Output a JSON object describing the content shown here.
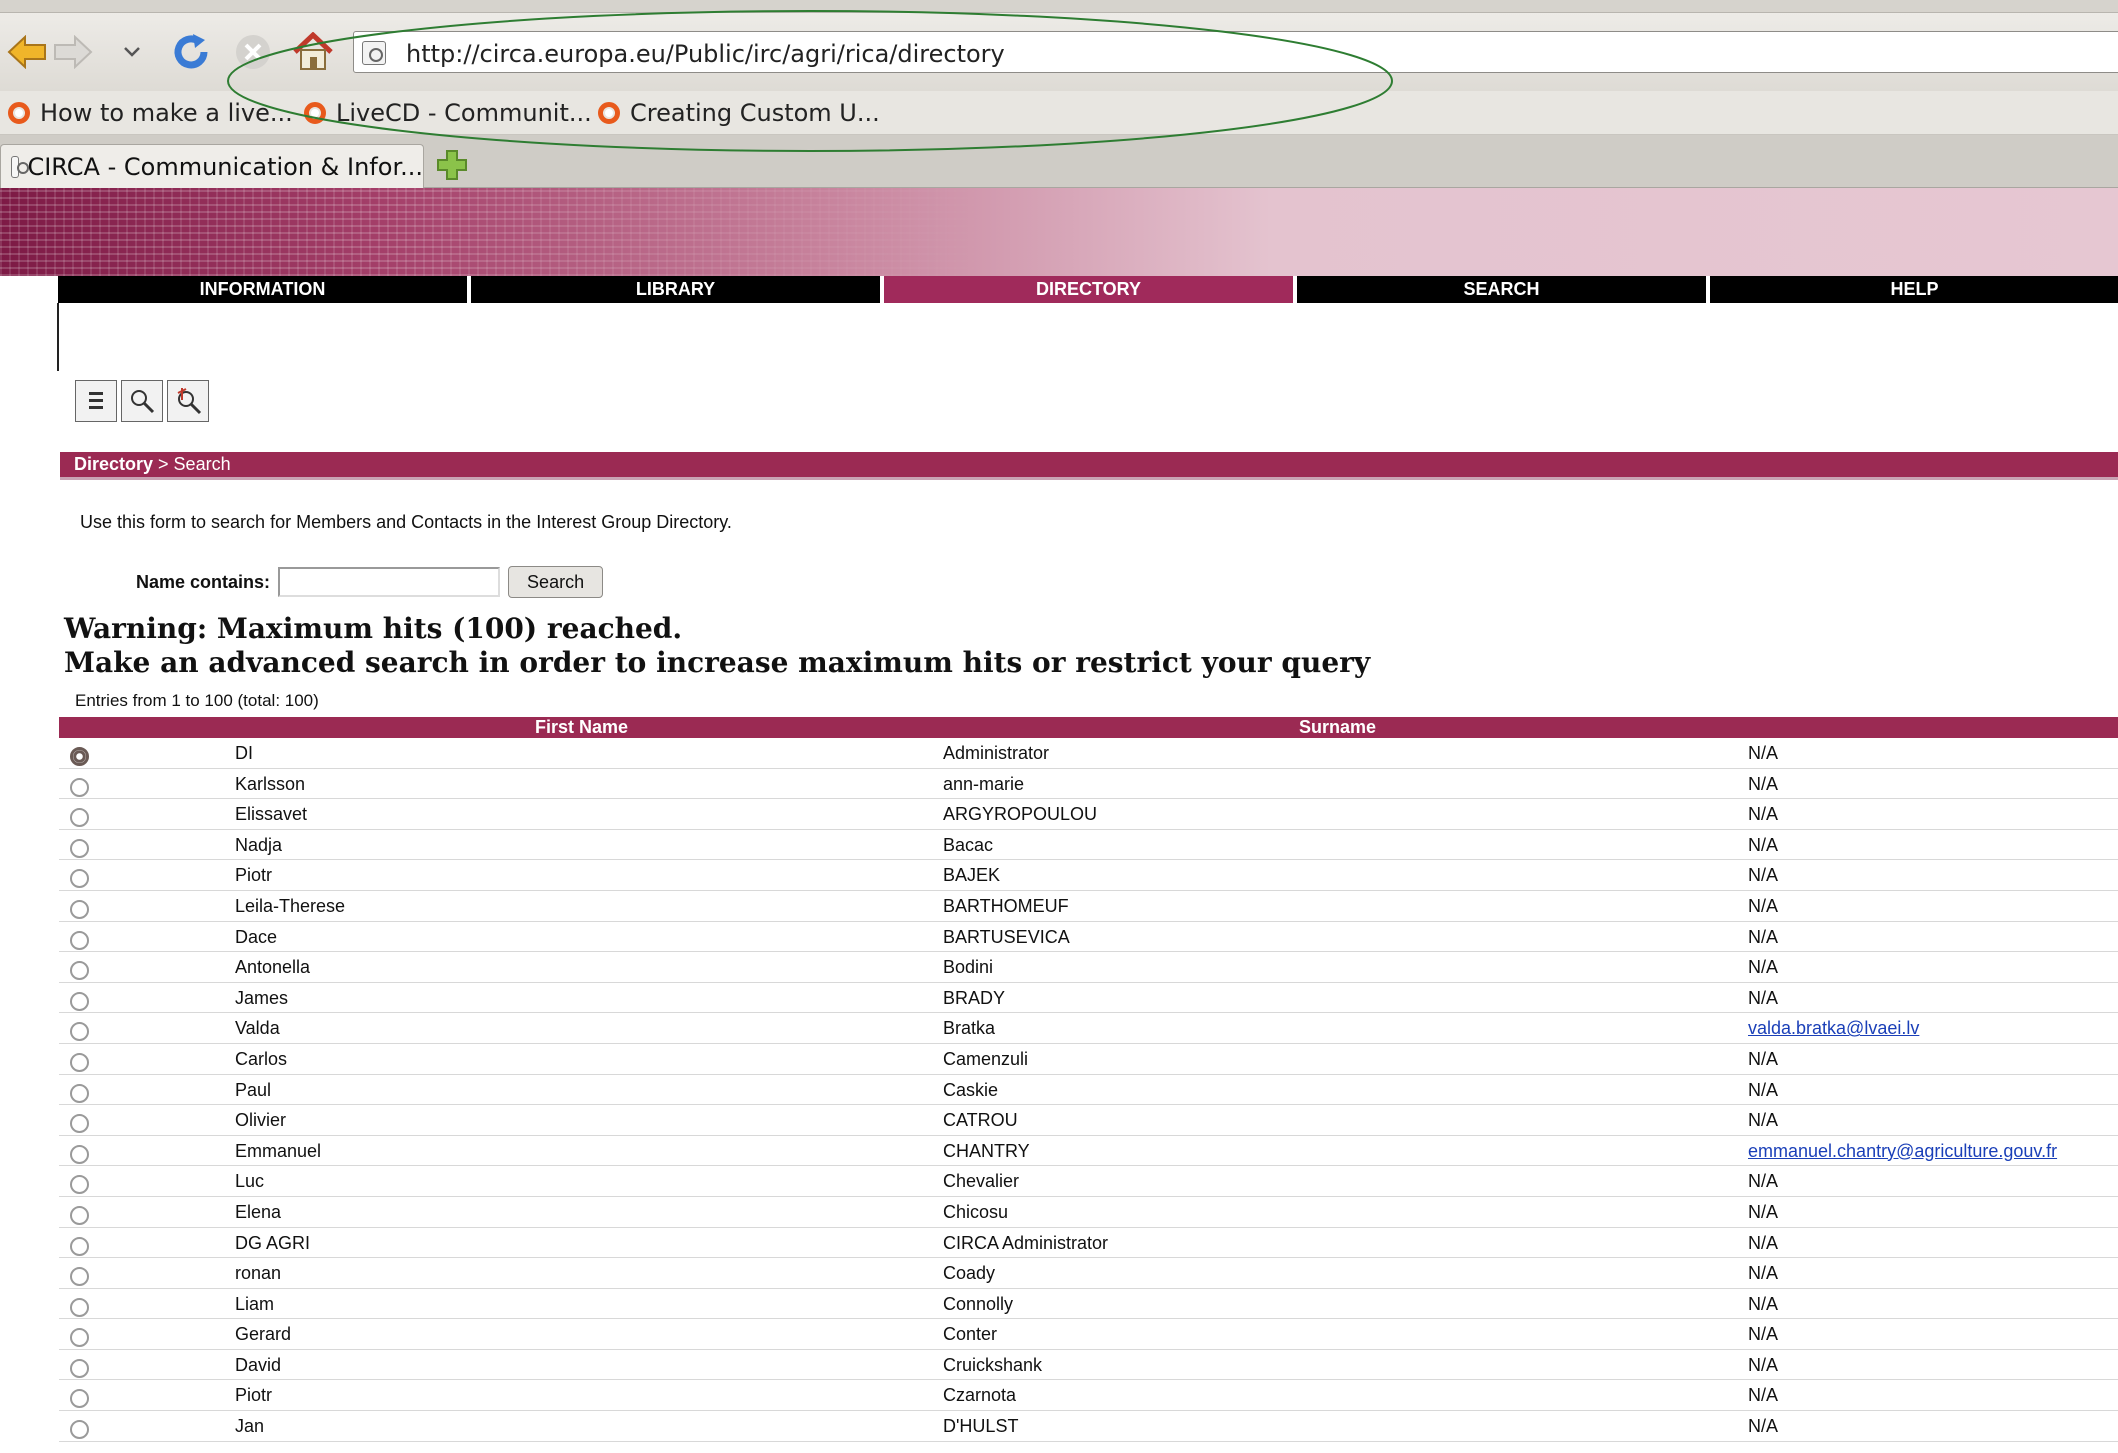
{
  "browser": {
    "url": "http://circa.europa.eu/Public/irc/agri/rica/directory",
    "bookmarks": [
      "How to make a live...",
      "LiveCD - Communit...",
      "Creating Custom U..."
    ],
    "tab_title": "CIRCA - Communication & Infor..."
  },
  "menu": {
    "items": [
      {
        "label": "INFORMATION",
        "active": false
      },
      {
        "label": "LIBRARY",
        "active": false
      },
      {
        "label": "DIRECTORY",
        "active": true
      },
      {
        "label": "SEARCH",
        "active": false
      },
      {
        "label": "HELP",
        "active": false
      }
    ]
  },
  "breadcrumb": {
    "root": "Directory",
    "separator": " > ",
    "current": "Search"
  },
  "intro_text": "Use this form to search for Members and Contacts in the Interest Group Directory.",
  "search_form": {
    "label": "Name contains:",
    "value": "",
    "button_label": "Search"
  },
  "warning": {
    "line1": "Warning: Maximum hits (100) reached.",
    "line2": "Make an advanced search in order to increase maximum hits or restrict your query"
  },
  "entries_text": "Entries from 1 to 100 (total: 100)",
  "table": {
    "headers": {
      "first_name": "First Name",
      "surname": "Surname"
    },
    "rows": [
      {
        "first": "DI",
        "surname": "Administrator",
        "email": "N/A",
        "selected": true
      },
      {
        "first": "Karlsson",
        "surname": "ann-marie",
        "email": "N/A"
      },
      {
        "first": "Elissavet",
        "surname": "ARGYROPOULOU",
        "email": "N/A"
      },
      {
        "first": "Nadja",
        "surname": "Bacac",
        "email": "N/A"
      },
      {
        "first": "Piotr",
        "surname": "BAJEK",
        "email": "N/A"
      },
      {
        "first": "Leila-Therese",
        "surname": "BARTHOMEUF",
        "email": "N/A"
      },
      {
        "first": "Dace",
        "surname": "BARTUSEVICA",
        "email": "N/A"
      },
      {
        "first": "Antonella",
        "surname": "Bodini",
        "email": "N/A"
      },
      {
        "first": "James",
        "surname": "BRADY",
        "email": "N/A"
      },
      {
        "first": "Valda",
        "surname": "Bratka",
        "email": "valda.bratka@lvaei.lv",
        "link": true
      },
      {
        "first": "Carlos",
        "surname": "Camenzuli",
        "email": "N/A"
      },
      {
        "first": "Paul",
        "surname": "Caskie",
        "email": "N/A"
      },
      {
        "first": "Olivier",
        "surname": "CATROU",
        "email": "N/A"
      },
      {
        "first": "Emmanuel",
        "surname": "CHANTRY",
        "email": "emmanuel.chantry@agriculture.gouv.fr",
        "link": true
      },
      {
        "first": "Luc",
        "surname": "Chevalier",
        "email": "N/A"
      },
      {
        "first": "Elena",
        "surname": "Chicosu",
        "email": "N/A"
      },
      {
        "first": "DG AGRI",
        "surname": "CIRCA Administrator",
        "email": "N/A"
      },
      {
        "first": "ronan",
        "surname": "Coady",
        "email": "N/A"
      },
      {
        "first": "Liam",
        "surname": "Connolly",
        "email": "N/A"
      },
      {
        "first": "Gerard",
        "surname": "Conter",
        "email": "N/A"
      },
      {
        "first": "David",
        "surname": "Cruickshank",
        "email": "N/A"
      },
      {
        "first": "Piotr",
        "surname": "Czarnota",
        "email": "N/A"
      },
      {
        "first": "Jan",
        "surname": "D'HULST",
        "email": "N/A"
      }
    ]
  },
  "colors": {
    "brand": "#9b2a53",
    "menu_bg": "#000000",
    "menu_active": "#a02a5b",
    "link": "#1a3fb8",
    "annotation": "#2e7d32"
  },
  "icons": [
    "back-arrow-icon",
    "forward-arrow-icon",
    "dropdown-icon",
    "reload-icon",
    "stop-icon",
    "home-icon",
    "page-icon",
    "ubuntu-icon",
    "add-tab-icon",
    "list-icon",
    "search-icon",
    "advanced-search-icon"
  ]
}
